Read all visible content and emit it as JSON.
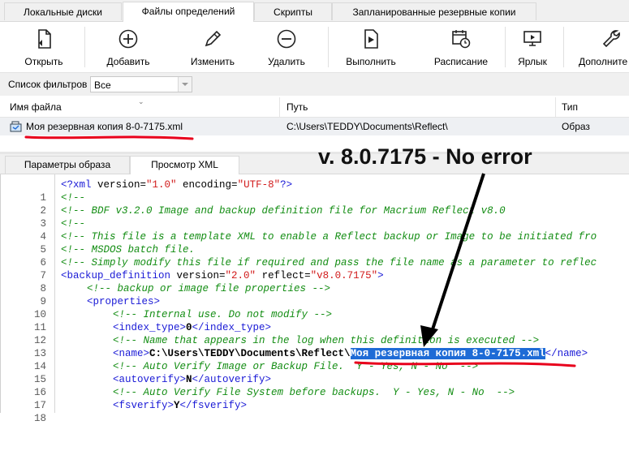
{
  "top_tabs": [
    {
      "label": "Локальные диски"
    },
    {
      "label": "Файлы определений"
    },
    {
      "label": "Скрипты"
    },
    {
      "label": "Запланированные резервные копии"
    }
  ],
  "toolbar": {
    "open": "Открыть",
    "add": "Добавить",
    "edit": "Изменить",
    "delete": "Удалить",
    "run": "Выполнить",
    "schedule": "Расписание",
    "shortcut": "Ярлык",
    "more": "Дополните"
  },
  "filter": {
    "label": "Список фильтров",
    "value": "Все"
  },
  "file_list": {
    "columns": [
      "Имя файла",
      "Путь",
      "Тип"
    ],
    "rows": [
      {
        "name": "Моя резервная копия 8-0-7175.xml",
        "path": "C:\\Users\\TEDDY\\Documents\\Reflect\\",
        "type": "Образ"
      }
    ]
  },
  "lower_tabs": [
    {
      "label": "Параметры образа"
    },
    {
      "label": "Просмотр XML"
    }
  ],
  "annotation": "v. 8.0.7175 - No error",
  "xml_lines": [
    {
      "n": "1"
    },
    {
      "n": "2"
    },
    {
      "n": "3"
    },
    {
      "n": "4"
    },
    {
      "n": "5"
    },
    {
      "n": "6"
    },
    {
      "n": "7"
    },
    {
      "n": "8"
    },
    {
      "n": "9"
    },
    {
      "n": "10"
    },
    {
      "n": "11"
    },
    {
      "n": "12"
    },
    {
      "n": "13"
    },
    {
      "n": "14"
    },
    {
      "n": "15"
    },
    {
      "n": "16"
    },
    {
      "n": "17"
    },
    {
      "n": "18"
    }
  ],
  "xml": {
    "l1a": "<?xml ",
    "l1b": "version=",
    "l1c": "\"1.0\"",
    "l1d": " encoding=",
    "l1e": "\"UTF-8\"",
    "l1f": "?>",
    "l2": "<!--",
    "l3": "<!-- BDF v3.2.0 Image and backup definition file for Macrium Reflect v8.0",
    "l4": "<!--",
    "l5": "<!-- This file is a template XML to enable a Reflect backup or Image to be initiated fro",
    "l6": "<!-- MSDOS batch file.",
    "l7": "<!-- Simply modify this file if required and pass the file name as a parameter to reflec",
    "l8a": "<backup_definition ",
    "l8b": "version=",
    "l8c": "\"2.0\"",
    "l8d": " reflect=",
    "l8e": "\"v8.0.7175\"",
    "l8f": ">",
    "l9": "<!-- backup or image file properties -->",
    "l10": "<properties>",
    "l11": "<!-- Internal use. Do not modify -->",
    "l12a": "<index_type>",
    "l12b": "0",
    "l12c": "</index_type>",
    "l13": "<!-- Name that appears in the log when this definition is executed -->",
    "l14a": "<name>",
    "l14b": "C:\\Users\\TEDDY\\Documents\\Reflect\\",
    "l14c": "Моя резервная копия 8-0-7175.xml",
    "l14d": "</name>",
    "l15": "<!-- Auto Verify Image or Backup File.  Y - Yes, N - No  -->",
    "l16a": "<autoverify>",
    "l16b": "N",
    "l16c": "</autoverify>",
    "l17": "<!-- Auto Verify File System before backups.  Y - Yes, N - No  -->",
    "l18a": "<fsverify>",
    "l18b": "Y",
    "l18c": "</fsverify>"
  },
  "colors": {
    "accent": "#1e6bd6",
    "annotation_line": "#e8001c",
    "comment": "#138d13",
    "tag": "#1a1ad6",
    "string": "#d11a1a"
  },
  "icons": [
    "open-file-icon",
    "add-plus-icon",
    "edit-pencil-icon",
    "delete-minus-icon",
    "run-play-icon",
    "schedule-calendar-icon",
    "shortcut-monitor-icon",
    "wrench-icon",
    "xml-file-icon"
  ]
}
